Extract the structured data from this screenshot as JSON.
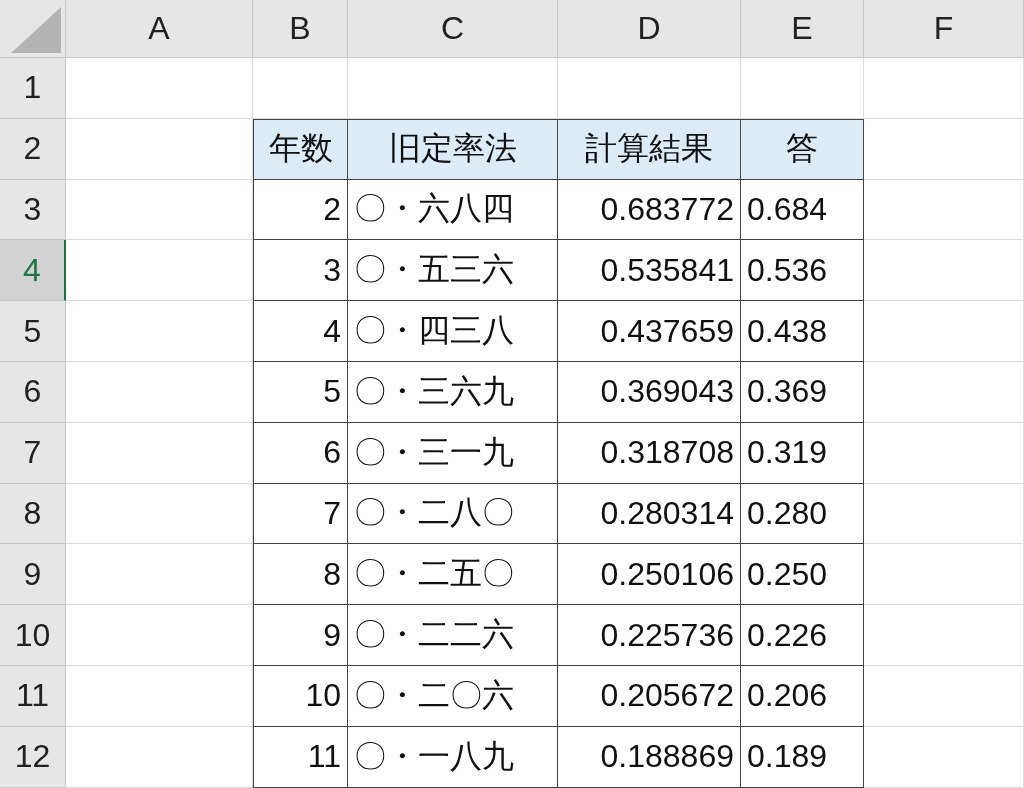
{
  "column_headers": [
    {
      "label": "A",
      "selected": false
    },
    {
      "label": "B",
      "selected": false
    },
    {
      "label": "C",
      "selected": false
    },
    {
      "label": "D",
      "selected": false
    },
    {
      "label": "E",
      "selected": false
    },
    {
      "label": "F",
      "selected": false
    }
  ],
  "row_headers": [
    {
      "label": "1",
      "selected": false
    },
    {
      "label": "2",
      "selected": false
    },
    {
      "label": "3",
      "selected": false
    },
    {
      "label": "4",
      "selected": true
    },
    {
      "label": "5",
      "selected": false
    },
    {
      "label": "6",
      "selected": false
    },
    {
      "label": "7",
      "selected": false
    },
    {
      "label": "8",
      "selected": false
    },
    {
      "label": "9",
      "selected": false
    },
    {
      "label": "10",
      "selected": false
    },
    {
      "label": "11",
      "selected": false
    },
    {
      "label": "12",
      "selected": false
    }
  ],
  "table": {
    "header": [
      "年数",
      "旧定率法",
      "計算結果",
      "答"
    ],
    "rows": [
      [
        "2",
        "〇・六八四",
        "0.683772",
        "0.684"
      ],
      [
        "3",
        "〇・五三六",
        "0.535841",
        "0.536"
      ],
      [
        "4",
        "〇・四三八",
        "0.437659",
        "0.438"
      ],
      [
        "5",
        "〇・三六九",
        "0.369043",
        "0.369"
      ],
      [
        "6",
        "〇・三一九",
        "0.318708",
        "0.319"
      ],
      [
        "7",
        "〇・二八〇",
        "0.280314",
        "0.280"
      ],
      [
        "8",
        "〇・二五〇",
        "0.250106",
        "0.250"
      ],
      [
        "9",
        "〇・二二六",
        "0.225736",
        "0.226"
      ],
      [
        "10",
        "〇・二〇六",
        "0.205672",
        "0.206"
      ],
      [
        "11",
        "〇・一八九",
        "0.188869",
        "0.189"
      ]
    ]
  }
}
